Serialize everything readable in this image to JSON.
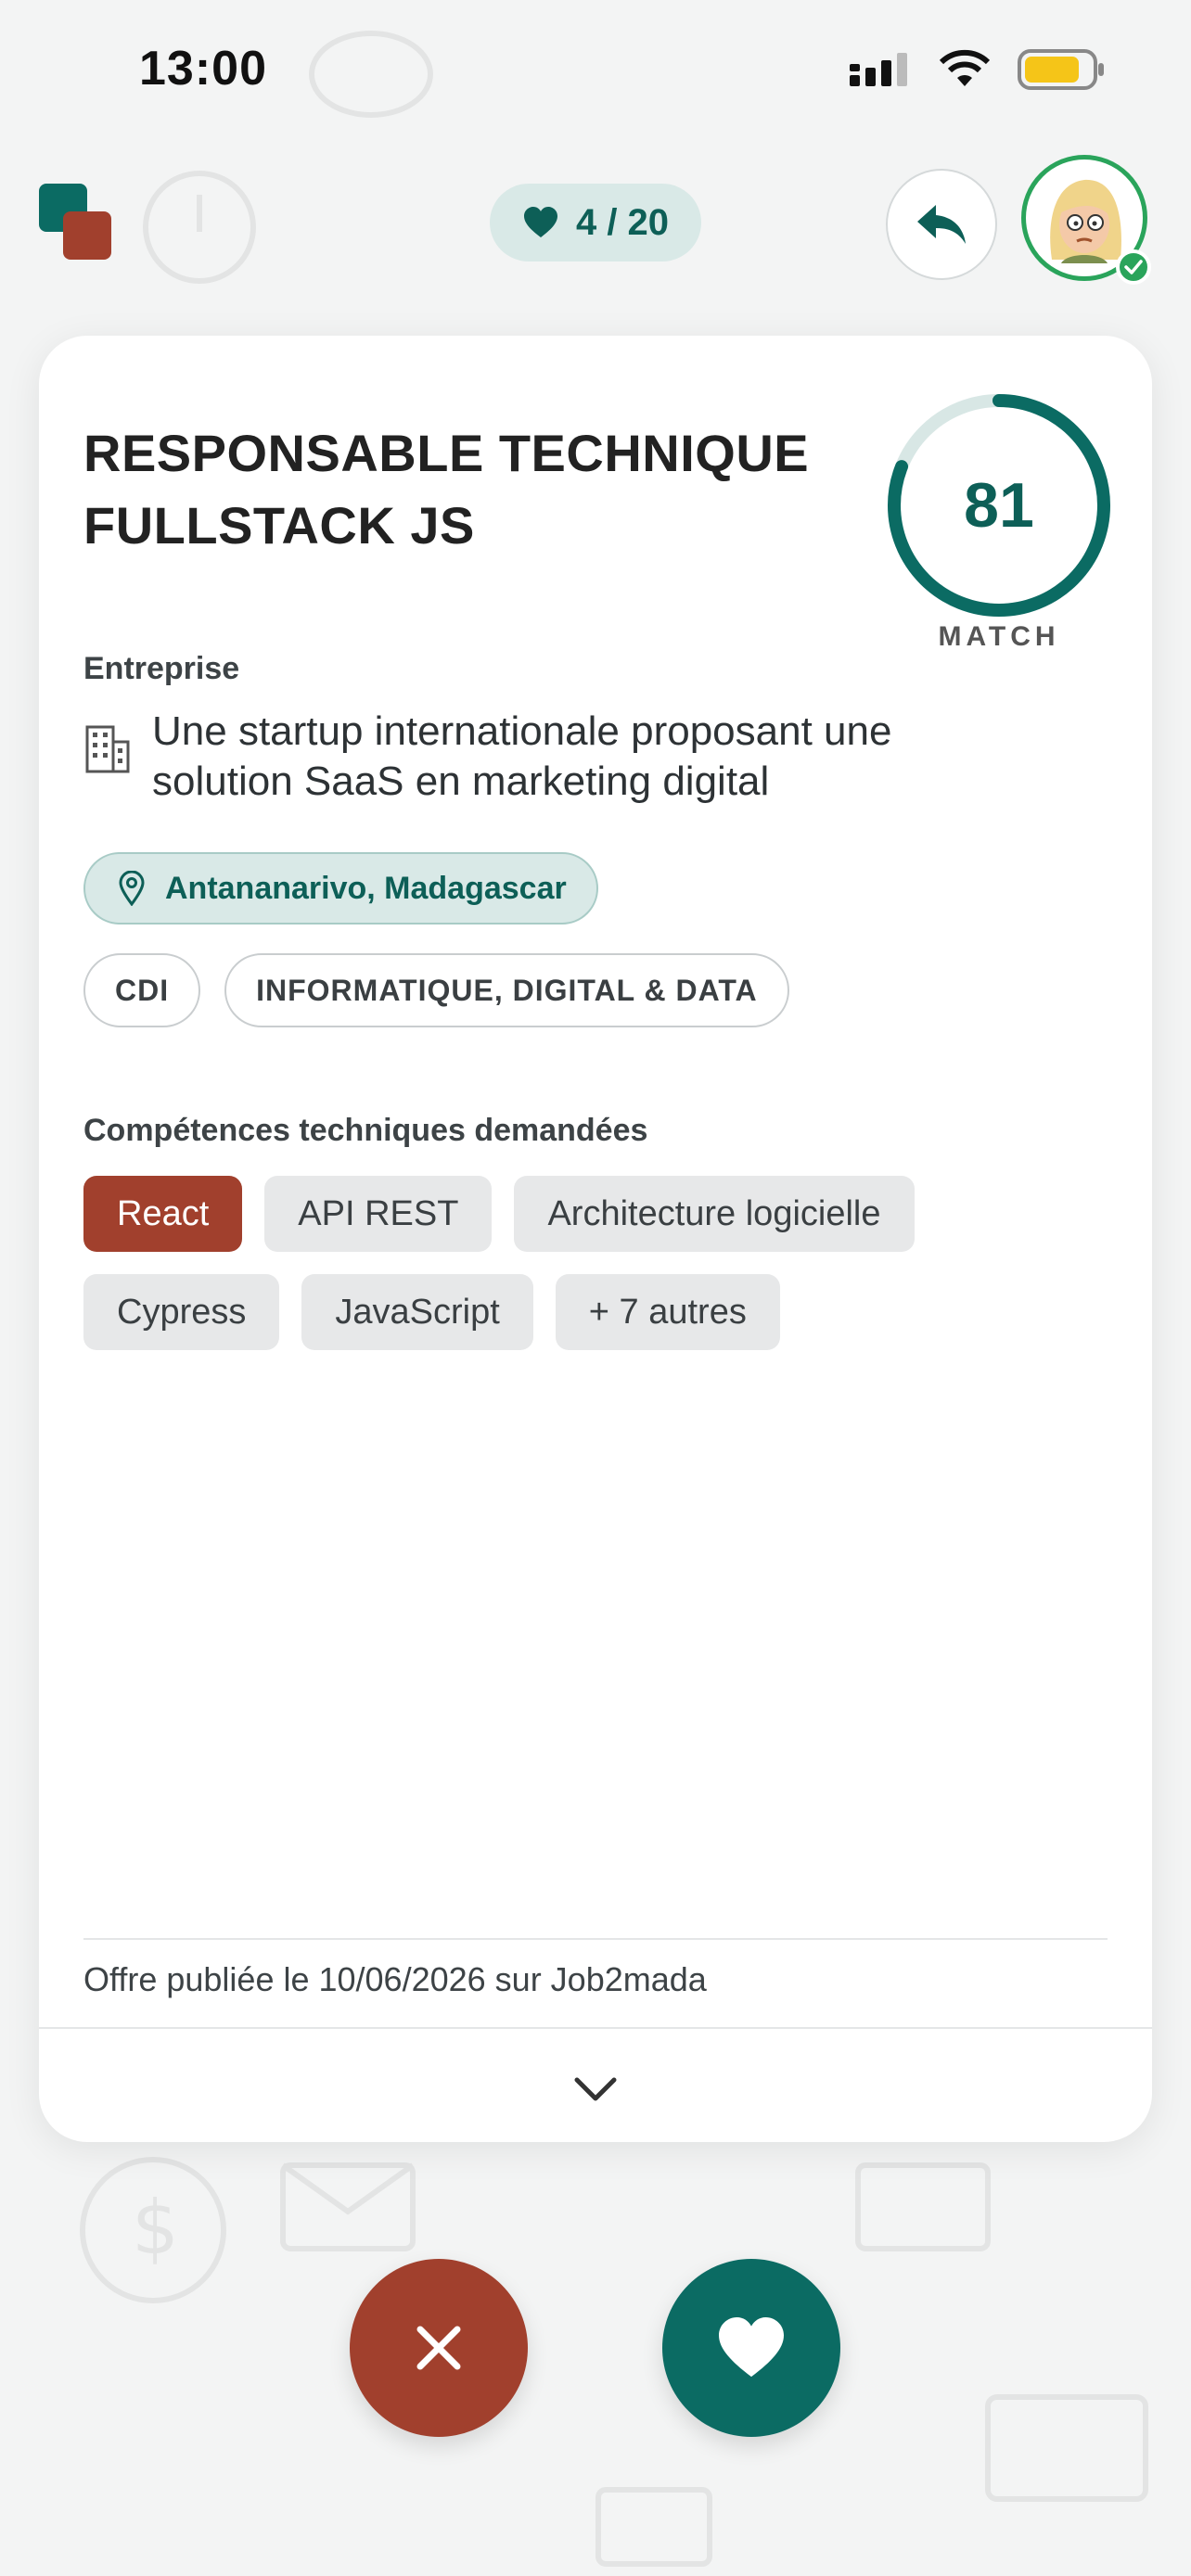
{
  "status_bar": {
    "time": "13:00"
  },
  "header": {
    "likes_count": "4 / 20"
  },
  "job": {
    "title_line1": "RESPONSABLE TECHNIQUE",
    "title_line2": "FULLSTACK JS",
    "match_score": "81",
    "match_label": "MATCH",
    "match_fraction": 0.81,
    "company_label": "Entreprise",
    "company_line1": "Une startup internationale proposant une",
    "company_line2": "solution SaaS en marketing digital",
    "location": "Antananarivo, Madagascar",
    "tags": [
      "CDI",
      "INFORMATIQUE, DIGITAL & DATA"
    ],
    "skills_label": "Compétences techniques demandées",
    "skills": [
      {
        "label": "React",
        "active": true
      },
      {
        "label": "API REST",
        "active": false
      },
      {
        "label": "Architecture logicielle",
        "active": false
      },
      {
        "label": "Cypress",
        "active": false
      },
      {
        "label": "JavaScript",
        "active": false
      },
      {
        "label": "+ 7 autres",
        "active": false
      }
    ],
    "published": "Offre publiée le 10/06/2026 sur Job2mada"
  },
  "colors": {
    "brand_teal": "#0b6b63",
    "brand_rust": "#a1402d",
    "online_green": "#2aa45b"
  },
  "icons": {
    "logo": "app-logo",
    "heart": "heart-icon",
    "back": "reply-arrow-icon",
    "building": "building-icon",
    "location": "map-pin-icon",
    "expand": "chevron-down-icon",
    "reject": "close-icon",
    "like": "heart-icon"
  }
}
